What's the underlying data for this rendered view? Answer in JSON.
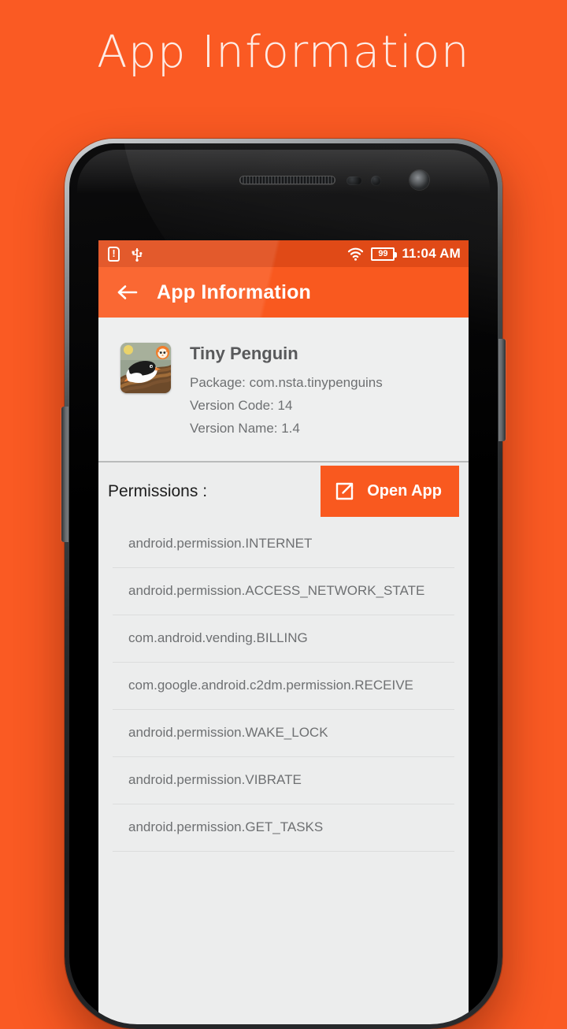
{
  "page": {
    "heading": "App Information",
    "background_color": "#fa5a23"
  },
  "phone": {
    "hardware": {
      "speaker_name": "earpiece-speaker",
      "camera_name": "front-camera",
      "volume_button": "volume-rocker",
      "power_button": "power-button"
    }
  },
  "status_bar": {
    "sim_icon": "sim-card-alert-icon",
    "usb_icon": "usb-icon",
    "wifi_icon": "wifi-icon",
    "battery_level": "99",
    "clock": "11:04 AM",
    "background_color": "#e04a17"
  },
  "app_bar": {
    "back_icon": "back-arrow-icon",
    "title": "App Information",
    "background_color": "#f9591f"
  },
  "app_card": {
    "icon_name": "tiny-penguin-app-icon",
    "app_name": "Tiny Penguin",
    "package_line": "Package: com.nsta.tinypenguins",
    "version_code_line": "Version Code: 14",
    "version_name_line": "Version Name: 1.4"
  },
  "permissions_section": {
    "title": "Permissions :",
    "open_app_button": {
      "label": "Open App",
      "icon": "external-link-icon",
      "color": "#f9591f"
    },
    "items": [
      "android.permission.INTERNET",
      "android.permission.ACCESS_NETWORK_STATE",
      "com.android.vending.BILLING",
      "com.google.android.c2dm.permission.RECEIVE",
      "android.permission.WAKE_LOCK",
      "android.permission.VIBRATE",
      "android.permission.GET_TASKS"
    ]
  }
}
